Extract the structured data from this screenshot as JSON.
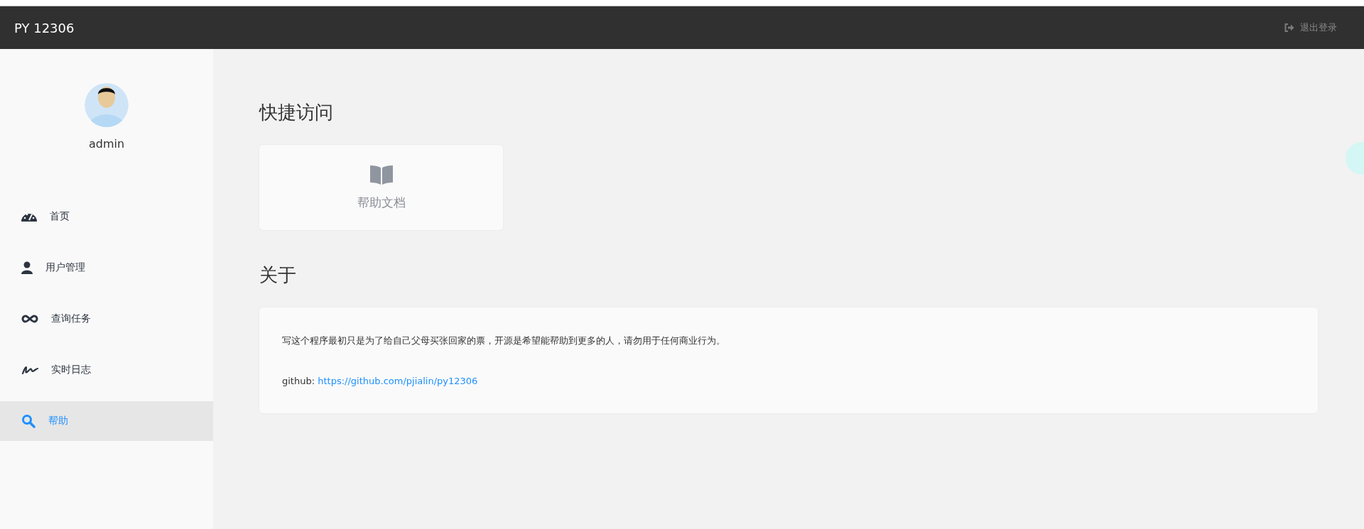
{
  "header": {
    "brand": "PY 12306",
    "logout": "退出登录"
  },
  "user": {
    "name": "admin"
  },
  "menu": [
    {
      "label": "首页",
      "kind": "dashboard",
      "selected": false
    },
    {
      "label": "用户管理",
      "kind": "user",
      "selected": false
    },
    {
      "label": "查询任务",
      "kind": "infinity",
      "selected": false
    },
    {
      "label": "实时日志",
      "kind": "signature",
      "selected": false
    },
    {
      "label": "帮助",
      "kind": "search",
      "selected": true
    }
  ],
  "quick_access": {
    "title": "快捷访问",
    "cards": [
      {
        "label": "帮助文档"
      }
    ]
  },
  "about": {
    "title": "关于",
    "text": "写这个程序最初只是为了给自己父母买张回家的票，开源是希望能帮助到更多的人，请勿用于任何商业行为。",
    "github_label": "github:",
    "github_link": "https://github.com/pjialin/py12306"
  }
}
